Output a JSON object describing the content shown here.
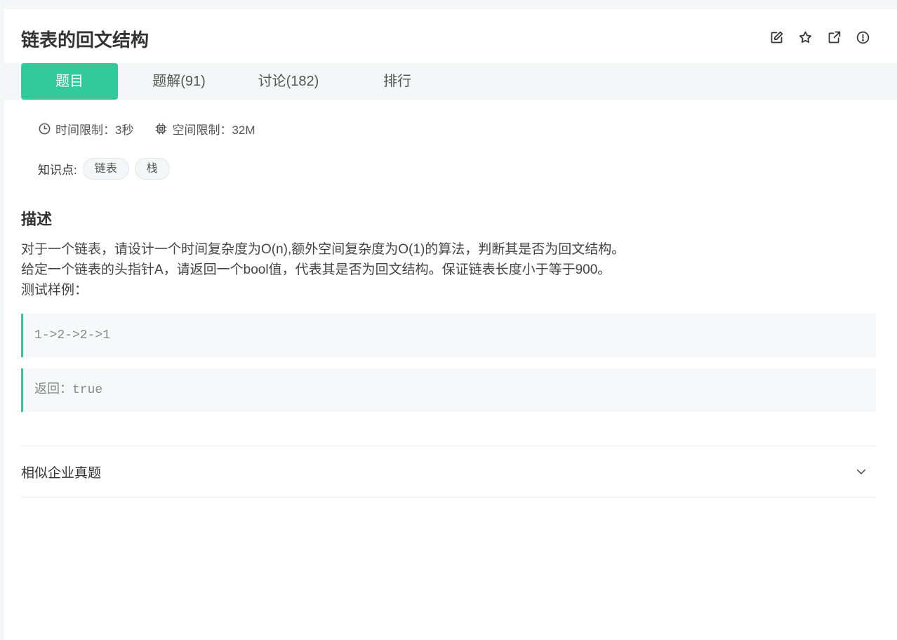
{
  "problem": {
    "title": "链表的回文结构"
  },
  "tabs": [
    {
      "label": "题目"
    },
    {
      "label": "题解(91)"
    },
    {
      "label": "讨论(182)"
    },
    {
      "label": "排行"
    }
  ],
  "limits": {
    "time": "时间限制：3秒",
    "space": "空间限制：32M"
  },
  "knowledge": {
    "label": "知识点:",
    "tags": [
      "链表",
      "栈"
    ]
  },
  "description": {
    "heading": "描述",
    "lines": [
      "对于一个链表，请设计一个时间复杂度为O(n),额外空间复杂度为O(1)的算法，判断其是否为回文结构。",
      "给定一个链表的头指针A，请返回一个bool值，代表其是否为回文结构。保证链表长度小于等于900。",
      "测试样例："
    ]
  },
  "examples": {
    "input": "1->2->2->1",
    "output": "返回：true"
  },
  "similar": {
    "label": "相似企业真题"
  },
  "colors": {
    "accent": "#32ca99"
  },
  "icons": [
    "edit-icon",
    "star-icon",
    "external-link-icon",
    "report-icon",
    "clock-icon",
    "chip-icon",
    "chevron-down-icon"
  ]
}
